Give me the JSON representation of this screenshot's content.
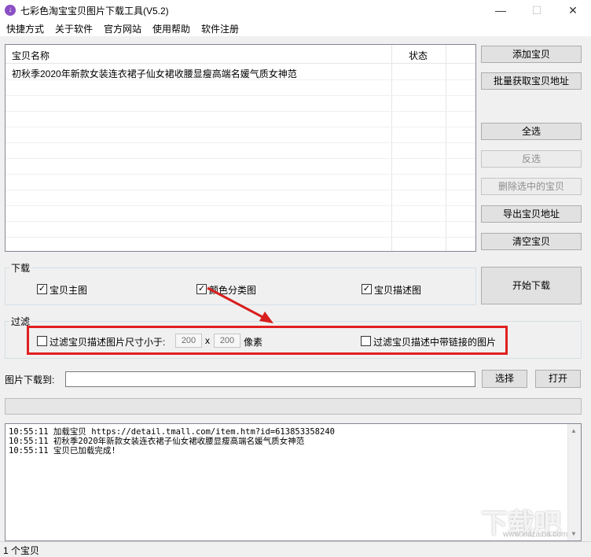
{
  "window": {
    "title": "七彩色淘宝宝贝图片下载工具(V5.2)",
    "minimize": "—",
    "maximize": "☐",
    "close": "✕"
  },
  "menu": [
    "快捷方式",
    "关于软件",
    "官方网站",
    "使用帮助",
    "软件注册"
  ],
  "list": {
    "columns": [
      "宝贝名称",
      "状态"
    ],
    "rows": [
      {
        "name": "初秋季2020年新款女装连衣裙子仙女裙收腰显瘦高端名媛气质女神范",
        "status": ""
      }
    ]
  },
  "side_buttons": {
    "add": "添加宝贝",
    "batch": "批量获取宝贝地址",
    "select_all": "全选",
    "invert": "反选",
    "delete_selected": "删除选中的宝贝",
    "export": "导出宝贝地址",
    "clear": "清空宝贝"
  },
  "download_group": {
    "label": "下载",
    "main_image": {
      "label": "宝贝主图",
      "checked": true
    },
    "color_image": {
      "label": "颜色分类图",
      "checked": true
    },
    "desc_image": {
      "label": "宝贝描述图",
      "checked": true
    },
    "start": "开始下载"
  },
  "filter_group": {
    "label": "过滤",
    "size_filter": {
      "label": "过滤宝贝描述图片尺寸小于:",
      "checked": false
    },
    "width": "200",
    "times": "x",
    "height": "200",
    "unit": "像素",
    "link_filter": {
      "label": "过滤宝贝描述中带链接的图片",
      "checked": false
    }
  },
  "path": {
    "label": "图片下载到:",
    "value": "",
    "choose": "选择",
    "open": "打开"
  },
  "progress": 0,
  "log": [
    "10:55:11 加载宝贝 https://detail.tmall.com/item.htm?id=613853358240",
    "10:55:11 初秋季2020年新款女装连衣裙子仙女裙收腰显瘦高端名媛气质女神范",
    "10:55:11 宝贝已加载完成!"
  ],
  "status": "1 个宝贝",
  "watermark": {
    "main": "下载吧",
    "sub": "www.xiazaiba.com"
  },
  "colors": {
    "highlight": "#e02020",
    "arrow": "#d81e1e"
  }
}
